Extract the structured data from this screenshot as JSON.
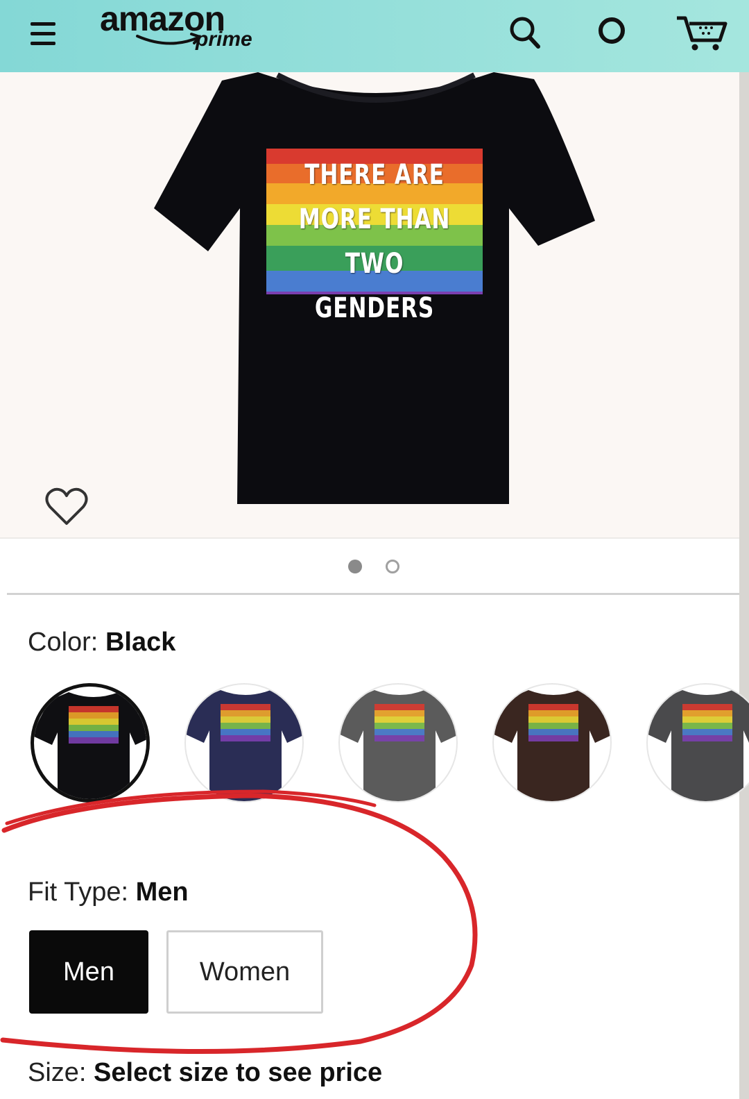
{
  "header": {
    "logo_word": "amazon",
    "logo_sub": "prime",
    "icons": [
      "menu-icon",
      "search-icon",
      "alexa-icon",
      "cart-icon"
    ]
  },
  "product": {
    "print_lines": [
      "THERE ARE",
      "MORE THAN",
      "TWO GENDERS"
    ],
    "image_page": 1,
    "image_count": 2
  },
  "color": {
    "label": "Color:",
    "value": "Black",
    "options": [
      {
        "name": "Black",
        "hex": "#0f0f12",
        "selected": true
      },
      {
        "name": "Navy",
        "hex": "#2a2d55",
        "selected": false
      },
      {
        "name": "Gray",
        "hex": "#5b5b5b",
        "selected": false
      },
      {
        "name": "Brown",
        "hex": "#3a2620",
        "selected": false
      },
      {
        "name": "Charcoal",
        "hex": "#4a4a4c",
        "selected": false
      }
    ]
  },
  "fit_type": {
    "label": "Fit Type:",
    "value": "Men",
    "options": [
      "Men",
      "Women"
    ]
  },
  "size": {
    "label": "Size:",
    "value": "Select size to see price"
  },
  "colors": {
    "header_bg": "#8fdcd9",
    "annotation_red": "#d8262a",
    "selected_button": "#0a0a0a"
  }
}
